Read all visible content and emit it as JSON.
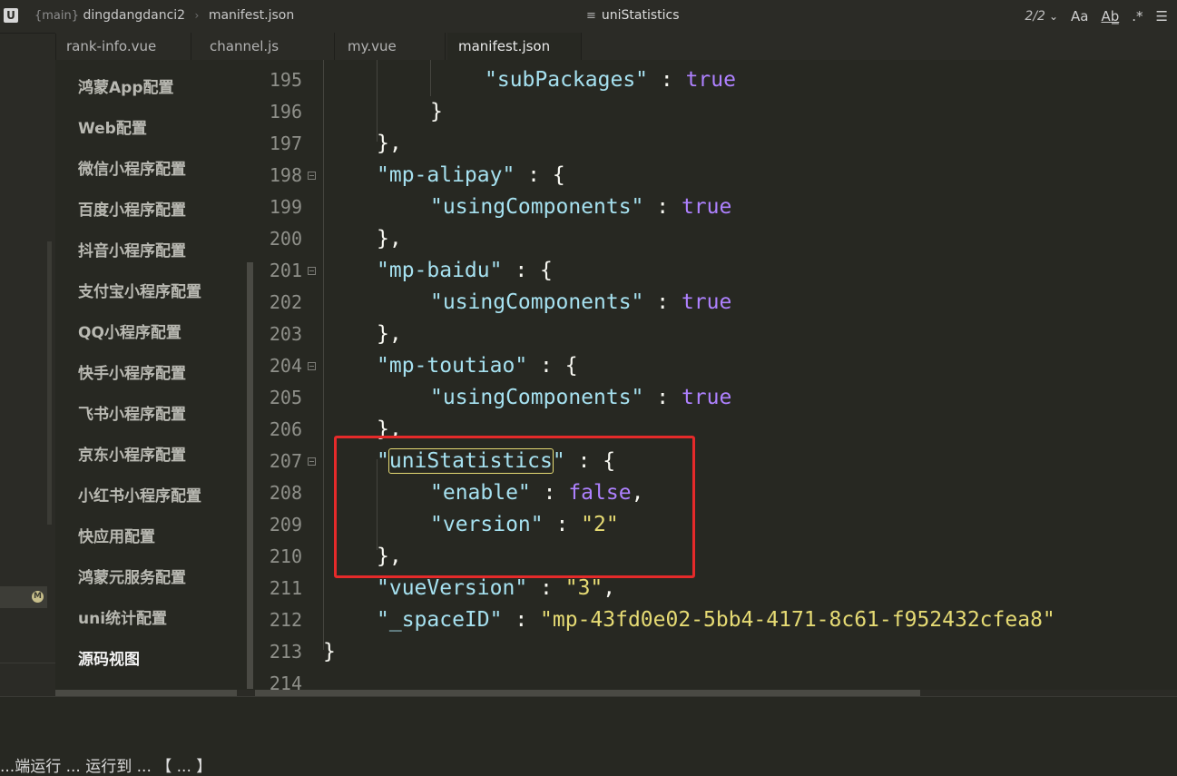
{
  "titlebar": {
    "app_icon": "U",
    "branch": "{main}",
    "project": "dingdangdanci2",
    "file": "manifest.json",
    "outline_symbol": "uniStatistics",
    "match_count": "2/2",
    "icons": [
      "chevron-down-icon",
      "match-case-icon",
      "whole-word-icon",
      "regex-icon",
      "menu-icon"
    ],
    "tool_glyphs": {
      "chevron": "⌄",
      "match_case": "Aa",
      "whole_word": "Ab̲",
      "regex": ".*",
      "menu": "☰"
    }
  },
  "tabs": [
    {
      "label": "rank-info.vue",
      "active": false
    },
    {
      "label": "channel.js",
      "active": false
    },
    {
      "label": "my.vue",
      "active": false
    },
    {
      "label": "manifest.json",
      "active": true
    }
  ],
  "strip": {
    "badge": "M"
  },
  "menu": {
    "items": [
      "鸿蒙App配置",
      "Web配置",
      "微信小程序配置",
      "百度小程序配置",
      "抖音小程序配置",
      "支付宝小程序配置",
      "QQ小程序配置",
      "快手小程序配置",
      "飞书小程序配置",
      "京东小程序配置",
      "小红书小程序配置",
      "快应用配置",
      "鸿蒙元服务配置",
      "uni统计配置",
      "源码视图"
    ],
    "current_index": 14
  },
  "editor": {
    "line_numbers": [
      "195",
      "196",
      "197",
      "198",
      "199",
      "200",
      "201",
      "202",
      "203",
      "204",
      "205",
      "206",
      "207",
      "208",
      "209",
      "210",
      "211",
      "212",
      "213",
      "214"
    ],
    "foldable": [
      "198",
      "201",
      "204",
      "207"
    ],
    "lines": {
      "l195_key": "\"subPackages\"",
      "l195_sep": " : ",
      "l195_val": "true",
      "l196": "}",
      "l197": "},",
      "l198_key": "\"mp-alipay\"",
      "l198_rest": " : {",
      "l199_key": "\"usingComponents\"",
      "l199_sep": " : ",
      "l199_val": "true",
      "l200": "},",
      "l201_key": "\"mp-baidu\"",
      "l201_rest": " : {",
      "l202_key": "\"usingComponents\"",
      "l202_sep": " : ",
      "l202_val": "true",
      "l203": "},",
      "l204_key": "\"mp-toutiao\"",
      "l204_rest": " : {",
      "l205_key": "\"usingComponents\"",
      "l205_sep": " : ",
      "l205_val": "true",
      "l206": "},",
      "l207_q1": "\"",
      "l207_word": "uniStatistics",
      "l207_q2": "\"",
      "l207_rest": " : {",
      "l208_key": "\"enable\"",
      "l208_sep": " : ",
      "l208_val": "false",
      "l208_comma": ",",
      "l209_key": "\"version\"",
      "l209_sep": " : ",
      "l209_val": "\"2\"",
      "l210": "},",
      "l211_key": "\"vueVersion\"",
      "l211_sep": " : ",
      "l211_val": "\"3\"",
      "l211_comma": ",",
      "l212_key": "\"_spaceID\"",
      "l212_sep": " : ",
      "l212_val": "\"mp-43fd0e02-5bb4-4171-8c61-f952432cfea8\"",
      "l213": "}"
    }
  },
  "console": {
    "text": "...端运行 ... 运行到 ... 【 ... 】"
  },
  "colors": {
    "editor_bg": "#272822",
    "key": "#a6e1f0",
    "boolean": "#ae81ff",
    "string": "#e6db74",
    "annotation_box": "#e52a2a"
  }
}
